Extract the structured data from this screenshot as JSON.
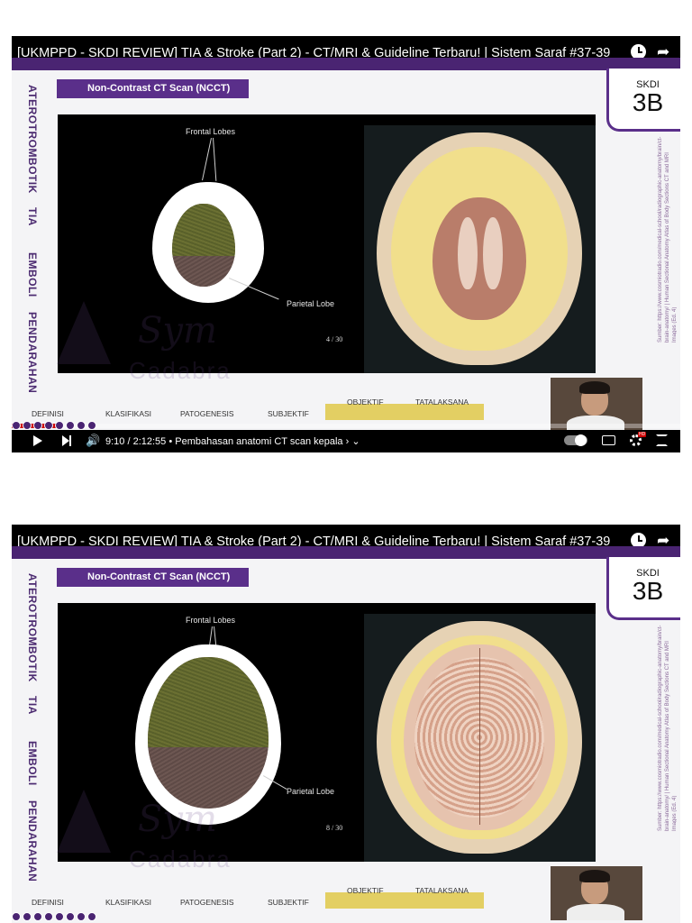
{
  "video_title": "[UKMPPD - SKDI REVIEW] TIA & Stroke (Part 2) - CT/MRI & Guideline Terbaru! | Sistem Saraf #37-39",
  "slide": {
    "title": "Non-Contrast CT Scan (NCCT)",
    "skdi_label": "SKDI",
    "skdi_level": "3B",
    "side_nav": [
      "ATEROTROMBOTIK",
      "TIA",
      "EMBOLI",
      "PENDARAHAN"
    ],
    "source_text": "Sumber: https://www.cosmiotradio.com/medical-school/radiographic-anatomy/brain/ct-brain-anatomy/ | Human Sectional Anatomy Atlas of Body Sections CT and MRI Images (Ed. 4)",
    "labels": {
      "frontal": "Frontal Lobes",
      "parietal": "Parietal Lobe"
    },
    "tabs": [
      {
        "label": "DEFINISI",
        "highlighted": false
      },
      {
        "label": "KLASIFIKASI",
        "highlighted": false
      },
      {
        "label": "PATOGENESIS",
        "highlighted": false
      },
      {
        "label": "SUBJEKTIF",
        "highlighted": false
      },
      {
        "label": "OBJEKTIF",
        "highlighted": true
      },
      {
        "label": "TATALAKSANA",
        "highlighted": true
      }
    ],
    "watermark_top": "Sym",
    "watermark_bottom": "Cadabra"
  },
  "frames": [
    {
      "page": "4 / 30"
    },
    {
      "page": "8 / 30"
    }
  ],
  "player": {
    "time": "9:10 / 2:12:55",
    "chapter": "• Pembahasan anatomi CT scan kepala ›",
    "chapter_caret": "⌄",
    "progress": 0.069,
    "colors": {
      "brand": "#5a2f8a",
      "tab_highlight": "#e3cf63",
      "progress": "#cc0000"
    }
  }
}
